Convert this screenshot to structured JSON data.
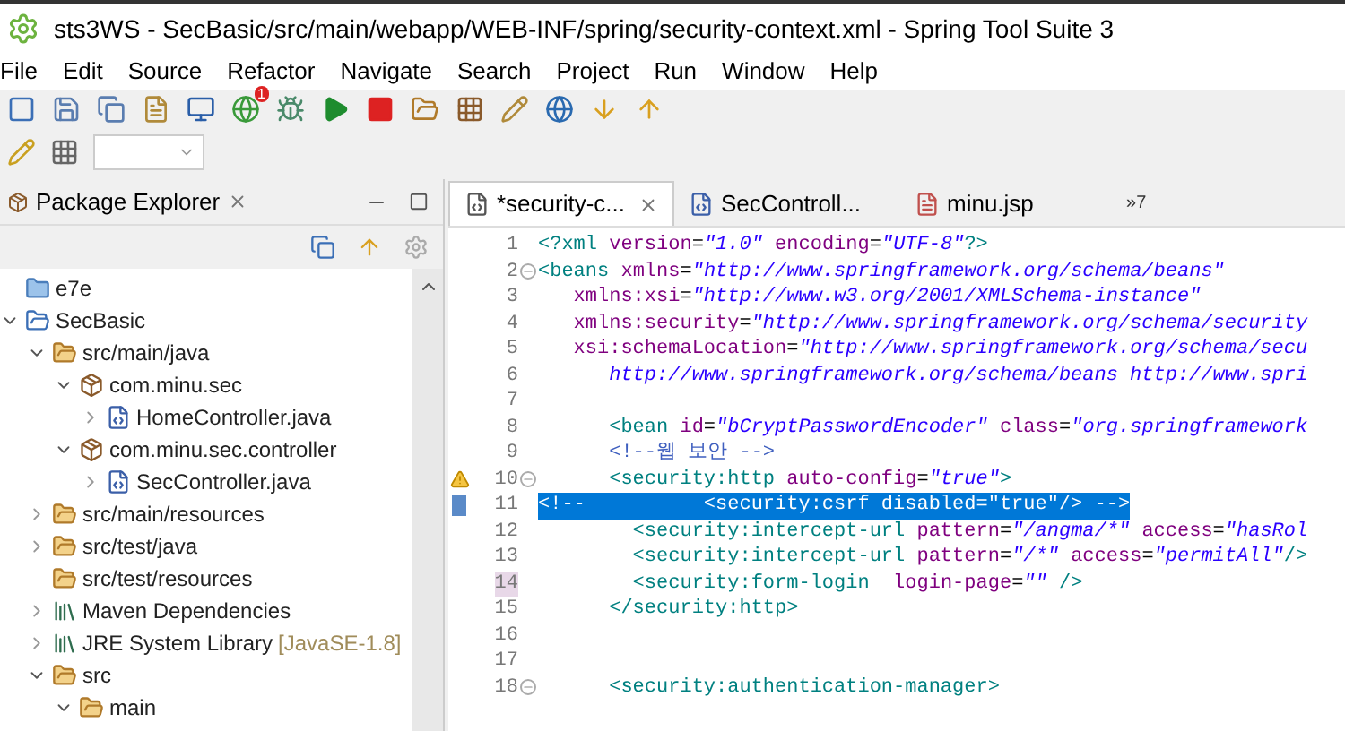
{
  "window": {
    "title": "sts3WS - SecBasic/src/main/webapp/WEB-INF/spring/security-context.xml - Spring Tool Suite 3"
  },
  "menu": [
    "File",
    "Edit",
    "Source",
    "Refactor",
    "Navigate",
    "Search",
    "Project",
    "Run",
    "Window",
    "Help"
  ],
  "toolbar_badge": "1",
  "explorer": {
    "title": "Package Explorer",
    "tree": [
      {
        "label": "e7e",
        "kind": "folder",
        "expanded": false,
        "leaf": true
      },
      {
        "label": "SecBasic",
        "kind": "project",
        "expanded": true,
        "leaf": false,
        "children": [
          {
            "label": "src/main/java",
            "kind": "source",
            "expanded": true,
            "leaf": false,
            "children": [
              {
                "label": "com.minu.sec",
                "kind": "package",
                "expanded": true,
                "leaf": false,
                "children": [
                  {
                    "label": "HomeController.java",
                    "kind": "java",
                    "expanded": false,
                    "leaf": false
                  }
                ]
              },
              {
                "label": "com.minu.sec.controller",
                "kind": "package",
                "expanded": true,
                "leaf": false,
                "children": [
                  {
                    "label": "SecController.java",
                    "kind": "java",
                    "expanded": false,
                    "leaf": false
                  }
                ]
              }
            ]
          },
          {
            "label": "src/main/resources",
            "kind": "source",
            "expanded": false,
            "leaf": false
          },
          {
            "label": "src/test/java",
            "kind": "source",
            "expanded": false,
            "leaf": false
          },
          {
            "label": "src/test/resources",
            "kind": "source",
            "expanded": false,
            "leaf": true
          },
          {
            "label": "Maven Dependencies",
            "kind": "library",
            "expanded": false,
            "leaf": false
          },
          {
            "label": "JRE System Library",
            "suffix": "[JavaSE-1.8]",
            "kind": "library",
            "expanded": false,
            "leaf": false
          },
          {
            "label": "src",
            "kind": "sfolder",
            "expanded": true,
            "leaf": false,
            "children": [
              {
                "label": "main",
                "kind": "sfolder",
                "expanded": true,
                "leaf": false
              }
            ]
          }
        ]
      }
    ]
  },
  "editor": {
    "tabs": [
      {
        "label": "*security-c...",
        "kind": "xml",
        "selected": true
      },
      {
        "label": "SecControll...",
        "kind": "java",
        "selected": false
      },
      {
        "label": "minu.jsp",
        "kind": "jsp",
        "selected": false
      }
    ],
    "overflow_glyph": "»",
    "overflow": "7",
    "lines": [
      {
        "n": "1",
        "fold": false,
        "warning": false,
        "selected": false,
        "changed": false,
        "tokens": [
          {
            "kind": "tag",
            "text": "<?xml "
          },
          {
            "kind": "attr",
            "text": "version"
          },
          {
            "kind": "plain",
            "text": "="
          },
          {
            "kind": "value",
            "text": "\"1.0\" "
          },
          {
            "kind": "attr",
            "text": "encoding"
          },
          {
            "kind": "plain",
            "text": "="
          },
          {
            "kind": "value",
            "text": "\"UTF-8\""
          },
          {
            "kind": "tag",
            "text": "?>"
          }
        ]
      },
      {
        "n": "2",
        "fold": true,
        "warning": false,
        "selected": false,
        "changed": false,
        "tokens": [
          {
            "kind": "tag",
            "text": "<beans "
          },
          {
            "kind": "attr",
            "text": "xmlns"
          },
          {
            "kind": "plain",
            "text": "="
          },
          {
            "kind": "value",
            "text": "\"http://www.springframework.org/schema/beans\""
          }
        ]
      },
      {
        "n": "3",
        "fold": false,
        "warning": false,
        "selected": false,
        "changed": false,
        "tokens": [
          {
            "kind": "attr",
            "text": "   xmlns:xsi"
          },
          {
            "kind": "plain",
            "text": "="
          },
          {
            "kind": "value",
            "text": "\"http://www.w3.org/2001/XMLSchema-instance\""
          }
        ]
      },
      {
        "n": "4",
        "fold": false,
        "warning": false,
        "selected": false,
        "changed": false,
        "tokens": [
          {
            "kind": "attr",
            "text": "   xmlns:security"
          },
          {
            "kind": "plain",
            "text": "="
          },
          {
            "kind": "value",
            "text": "\"http://www.springframework.org/schema/security"
          }
        ]
      },
      {
        "n": "5",
        "fold": false,
        "warning": false,
        "selected": false,
        "changed": false,
        "tokens": [
          {
            "kind": "attr",
            "text": "   xsi:schemaLocation"
          },
          {
            "kind": "plain",
            "text": "="
          },
          {
            "kind": "value",
            "text": "\"http://www.springframework.org/schema/secu"
          }
        ]
      },
      {
        "n": "6",
        "fold": false,
        "warning": false,
        "selected": false,
        "changed": false,
        "tokens": [
          {
            "kind": "value",
            "text": "      http://www.springframework.org/schema/beans http://www.spri"
          }
        ]
      },
      {
        "n": "7",
        "fold": false,
        "warning": false,
        "selected": false,
        "changed": false
      },
      {
        "n": "8",
        "fold": false,
        "warning": false,
        "selected": false,
        "changed": false,
        "tokens": [
          {
            "kind": "tag",
            "text": "      <bean "
          },
          {
            "kind": "attr",
            "text": "id"
          },
          {
            "kind": "plain",
            "text": "="
          },
          {
            "kind": "value",
            "text": "\"bCryptPasswordEncoder\" "
          },
          {
            "kind": "attr",
            "text": "class"
          },
          {
            "kind": "plain",
            "text": "="
          },
          {
            "kind": "value",
            "text": "\"org.springframework"
          }
        ]
      },
      {
        "n": "9",
        "fold": false,
        "warning": false,
        "selected": false,
        "changed": false,
        "tokens": [
          {
            "kind": "comment",
            "text": "      <!--웹 보안 -->"
          }
        ]
      },
      {
        "n": "10",
        "fold": true,
        "warning": true,
        "selected": false,
        "changed": false,
        "tokens": [
          {
            "kind": "tag",
            "text": "      <security:http "
          },
          {
            "kind": "attr",
            "text": "auto-config"
          },
          {
            "kind": "plain",
            "text": "="
          },
          {
            "kind": "value",
            "text": "\"true\""
          },
          {
            "kind": "tag",
            "text": ">"
          }
        ]
      },
      {
        "n": "11",
        "fold": false,
        "warning": false,
        "selected": true,
        "changed": false,
        "tokens": [
          {
            "kind": "comment",
            "text": "<!--          <security:csrf disabled=\"true\"/> -->"
          }
        ]
      },
      {
        "n": "12",
        "fold": false,
        "warning": false,
        "selected": false,
        "changed": false,
        "tokens": [
          {
            "kind": "tag",
            "text": "        <security:intercept-url "
          },
          {
            "kind": "attr",
            "text": "pattern"
          },
          {
            "kind": "plain",
            "text": "="
          },
          {
            "kind": "value",
            "text": "\"/angma/*\" "
          },
          {
            "kind": "attr",
            "text": "access"
          },
          {
            "kind": "plain",
            "text": "="
          },
          {
            "kind": "value",
            "text": "\"hasRol"
          }
        ]
      },
      {
        "n": "13",
        "fold": false,
        "warning": false,
        "selected": false,
        "changed": false,
        "tokens": [
          {
            "kind": "tag",
            "text": "        <security:intercept-url "
          },
          {
            "kind": "attr",
            "text": "pattern"
          },
          {
            "kind": "plain",
            "text": "="
          },
          {
            "kind": "value",
            "text": "\"/*\" "
          },
          {
            "kind": "attr",
            "text": "access"
          },
          {
            "kind": "plain",
            "text": "="
          },
          {
            "kind": "value",
            "text": "\"permitAll\""
          },
          {
            "kind": "tag",
            "text": "/>"
          }
        ]
      },
      {
        "n": "14",
        "fold": false,
        "warning": false,
        "selected": false,
        "changed": true,
        "tokens": [
          {
            "kind": "tag",
            "text": "        <security:form-login  "
          },
          {
            "kind": "attr",
            "text": "login-page"
          },
          {
            "kind": "plain",
            "text": "="
          },
          {
            "kind": "value",
            "text": "\"\""
          },
          {
            "kind": "tag",
            "text": " />"
          }
        ]
      },
      {
        "n": "15",
        "fold": false,
        "warning": false,
        "selected": false,
        "changed": false,
        "tokens": [
          {
            "kind": "tag",
            "text": "      </security:http>"
          }
        ]
      },
      {
        "n": "16",
        "fold": false,
        "warning": false,
        "selected": false,
        "changed": false
      },
      {
        "n": "17",
        "fold": false,
        "warning": false,
        "selected": false,
        "changed": false
      },
      {
        "n": "18",
        "fold": true,
        "warning": false,
        "selected": false,
        "changed": false,
        "tokens": [
          {
            "kind": "tag",
            "text": "      <security:authentication-manager>"
          }
        ]
      }
    ]
  }
}
